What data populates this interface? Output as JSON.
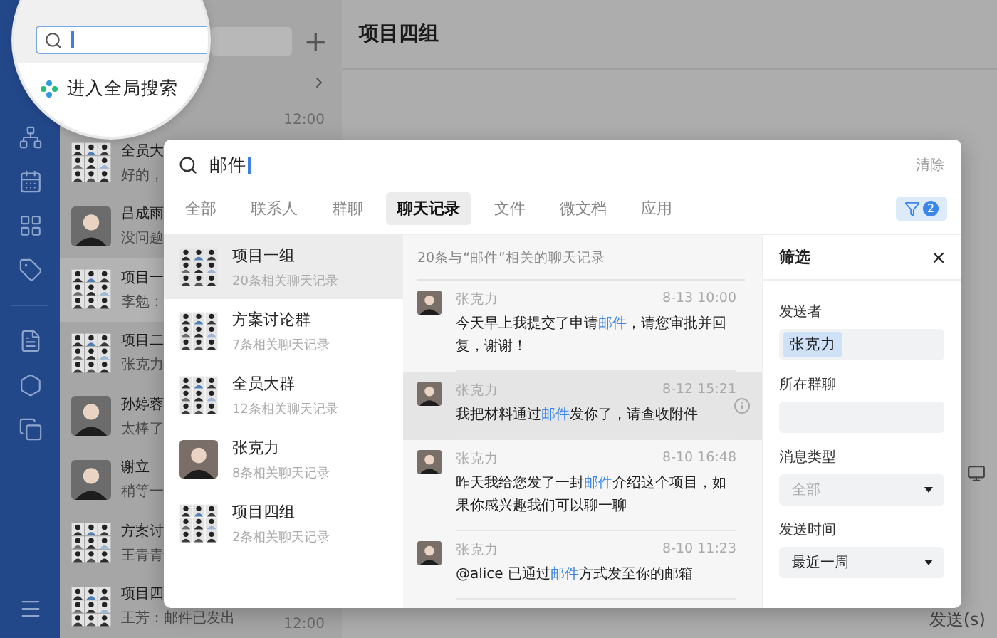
{
  "chat_list": {
    "add_button": "+",
    "global_search_label": "进入全局搜索",
    "items": [
      {
        "time": "12:00"
      },
      {
        "kind": "group",
        "name": "全员大",
        "preview": "好的，",
        "selected": false
      },
      {
        "kind": "person",
        "name": "吕成雨",
        "preview": "没问题",
        "selected": false
      },
      {
        "kind": "group",
        "name": "项目一",
        "preview": "李勉：",
        "selected": true
      },
      {
        "kind": "group",
        "name": "项目二",
        "preview": "张克力",
        "selected": false
      },
      {
        "kind": "person",
        "name": "孙婷蓉",
        "preview": "太棒了",
        "selected": false
      },
      {
        "kind": "person",
        "name": "谢立",
        "preview": "稍等一",
        "selected": false
      },
      {
        "kind": "group",
        "name": "方案讨",
        "preview": "王青青",
        "selected": false
      },
      {
        "kind": "group",
        "name": "项目四",
        "preview": "王芳：邮件已发出",
        "time": "12:00",
        "selected": false
      }
    ]
  },
  "conversation": {
    "title": "项目四组",
    "send_button": "发送(s)"
  },
  "search_dialog": {
    "query": "邮件",
    "clear": "清除",
    "filter_count": "2",
    "tabs": [
      {
        "label": "全部",
        "selected": false
      },
      {
        "label": "联系人",
        "selected": false
      },
      {
        "label": "群聊",
        "selected": false
      },
      {
        "label": "聊天记录",
        "selected": true
      },
      {
        "label": "文件",
        "selected": false
      },
      {
        "label": "微文档",
        "selected": false
      },
      {
        "label": "应用",
        "selected": false
      }
    ],
    "results": [
      {
        "kind": "group",
        "name": "项目一组",
        "count": "20条相关聊天记录",
        "selected": true
      },
      {
        "kind": "group",
        "name": "方案讨论群",
        "count": "7条相关聊天记录",
        "selected": false
      },
      {
        "kind": "group",
        "name": "全员大群",
        "count": "12条相关聊天记录",
        "selected": false
      },
      {
        "kind": "person",
        "name": "张克力",
        "count": "8条相关聊天记录",
        "selected": false
      },
      {
        "kind": "group",
        "name": "项目四组",
        "count": "2条相关聊天记录",
        "selected": false
      }
    ],
    "messages_header": "20条与“邮件”相关的聊天记录",
    "messages": [
      {
        "sender": "张克力",
        "time": "8-13 10:00",
        "hovered": false,
        "segments": [
          {
            "text": "今天早上我提交了申请",
            "highlight": false
          },
          {
            "text": "邮件",
            "highlight": true
          },
          {
            "text": "，请您审批并回复，谢谢！",
            "highlight": false
          }
        ]
      },
      {
        "sender": "张克力",
        "time": "8-12 15:21",
        "hovered": true,
        "segments": [
          {
            "text": "我把材料通过",
            "highlight": false
          },
          {
            "text": "邮件",
            "highlight": true
          },
          {
            "text": "发你了，请查收附件",
            "highlight": false
          }
        ]
      },
      {
        "sender": "张克力",
        "time": "8-10 16:48",
        "hovered": false,
        "segments": [
          {
            "text": "昨天我给您发了一封",
            "highlight": false
          },
          {
            "text": "邮件",
            "highlight": true
          },
          {
            "text": "介绍这个项目，如果你感兴趣我们可以聊一聊",
            "highlight": false
          }
        ]
      },
      {
        "sender": "张克力",
        "time": "8-10 11:23",
        "hovered": false,
        "segments": [
          {
            "text": "@alice 已通过",
            "highlight": false
          },
          {
            "text": "邮件",
            "highlight": true
          },
          {
            "text": "方式发至你的邮箱",
            "highlight": false
          }
        ]
      }
    ],
    "filter_panel": {
      "title": "筛选",
      "fields": [
        {
          "kind": "chips",
          "label": "发送者",
          "chips": [
            "张克力"
          ]
        },
        {
          "kind": "input",
          "label": "所在群聊"
        },
        {
          "kind": "select",
          "label": "消息类型",
          "placeholder": "全部"
        },
        {
          "kind": "select",
          "label": "发送时间",
          "value": "最近一周"
        }
      ]
    }
  }
}
